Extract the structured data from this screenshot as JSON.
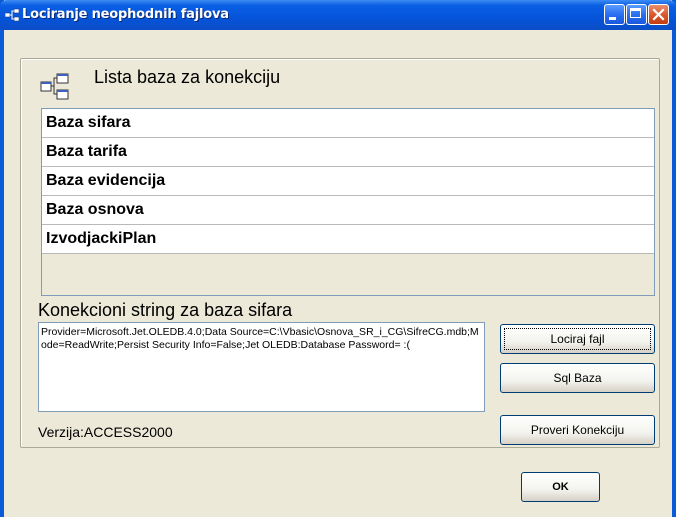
{
  "window": {
    "title": "Lociranje neophodnih fajlova"
  },
  "list": {
    "title": "Lista baza za konekciju",
    "items": [
      "Baza sifara",
      "Baza tarifa",
      "Baza evidencija",
      "Baza osnova",
      "IzvodjackiPlan"
    ]
  },
  "connection": {
    "label": "Konekcioni string za baza sifara",
    "value": "Provider=Microsoft.Jet.OLEDB.4.0;Data Source=C:\\Vbasic\\Osnova_SR_i_CG\\SifreCG.mdb;Mode=ReadWrite;Persist Security Info=False;Jet OLEDB:Database Password= :("
  },
  "buttons": {
    "locate": "Lociraj fajl",
    "sql": "Sql Baza",
    "check": "Proveri Konekciju",
    "ok": "OK"
  },
  "version_text": "Verzija:ACCESS2000",
  "colors": {
    "titlebar": "#0554da",
    "face": "#ece9d8",
    "border": "#7f9db9"
  }
}
